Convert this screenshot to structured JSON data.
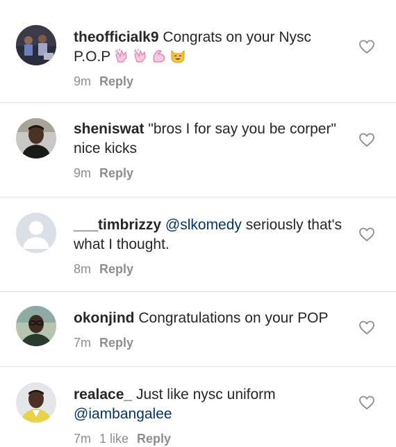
{
  "comments": [
    {
      "username": "theofficialk9",
      "text": "Congrats on your Nysc P.O.P",
      "emojis": [
        "clapping-hands-emoji",
        "clapping-hands-emoji",
        "flexed-biceps-emoji",
        "grinning-cat-emoji"
      ],
      "time": "9m",
      "likes": "",
      "reply": "Reply",
      "avatar": "group-photo-avatar"
    },
    {
      "username": "sheniswat",
      "text": "\"bros I for say you be corper\" nice kicks",
      "time": "9m",
      "likes": "",
      "reply": "Reply",
      "avatar": "man-portrait-avatar"
    },
    {
      "username": "___timbrizzy",
      "mention": "@slkomedy",
      "text": "seriously that's what I thought.",
      "time": "8m",
      "likes": "",
      "reply": "Reply",
      "avatar": "default-avatar"
    },
    {
      "username": "okonjind",
      "text": "Congratulations on your POP",
      "time": "7m",
      "likes": "",
      "reply": "Reply",
      "avatar": "man-with-glasses-avatar"
    },
    {
      "username": "realace_",
      "text": "Just like nysc uniform",
      "mention": "@iambangalee",
      "time": "7m",
      "likes": "1 like",
      "reply": "Reply",
      "avatar": "man-portrait-avatar"
    }
  ],
  "colors": {
    "text": "#262626",
    "meta": "#8e8e8e",
    "mention": "#003569",
    "divider": "#e4e4e4"
  }
}
